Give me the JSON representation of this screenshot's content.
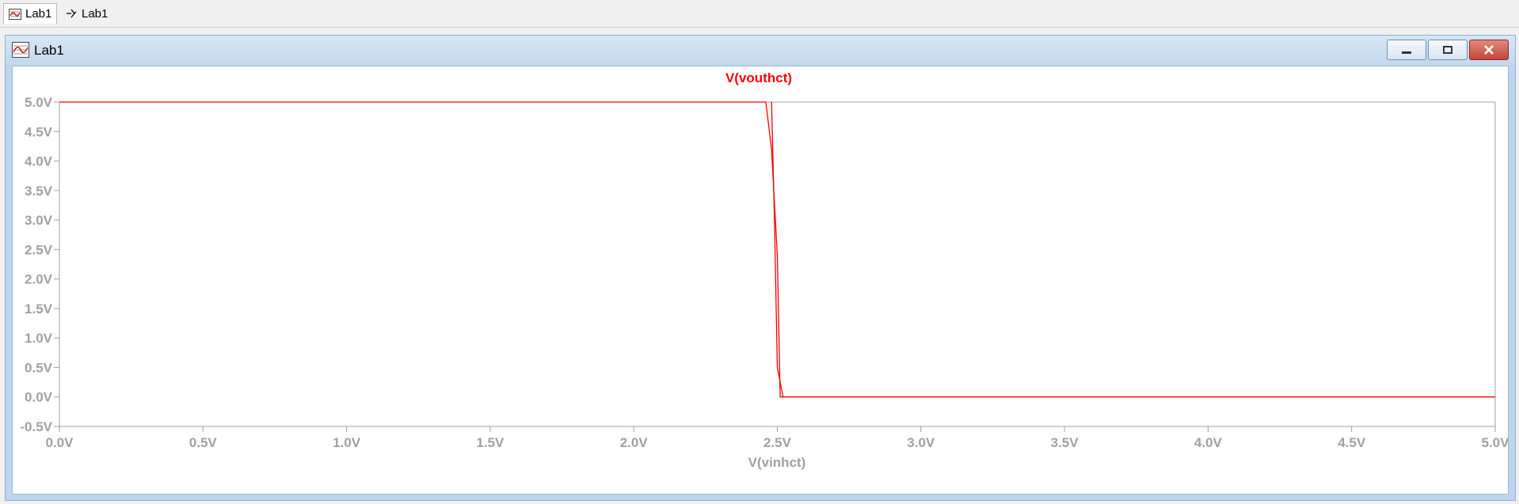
{
  "tabs": [
    {
      "label": "Lab1",
      "icon": "waveform-icon"
    },
    {
      "label": "Lab1",
      "icon": "schematic-icon"
    }
  ],
  "window": {
    "title": "Lab1",
    "icon": "waveform-icon",
    "buttons": [
      "minimize",
      "maximize",
      "close"
    ]
  },
  "colors": {
    "trace": "#ff0000",
    "axis_text": "#a0a0a0",
    "frame": "#a0a0a0"
  },
  "chart_data": {
    "type": "line",
    "title": "V(vouthct)",
    "xlabel": "V(vinhct)",
    "ylabel": "",
    "xlim": [
      0.0,
      5.0
    ],
    "ylim": [
      -0.5,
      5.0
    ],
    "x_ticks": [
      "0.0V",
      "0.5V",
      "1.0V",
      "1.5V",
      "2.0V",
      "2.5V",
      "3.0V",
      "3.5V",
      "4.0V",
      "4.5V",
      "5.0V"
    ],
    "y_ticks": [
      "5.0V",
      "4.5V",
      "4.0V",
      "3.5V",
      "3.0V",
      "2.5V",
      "2.0V",
      "1.5V",
      "1.0V",
      "0.5V",
      "0.0V",
      "-0.5V"
    ],
    "grid": false,
    "series": [
      {
        "name": "V(vouthct)",
        "x": [
          0.0,
          2.46,
          2.48,
          2.5,
          2.51,
          5.0
        ],
        "y": [
          5.0,
          5.0,
          4.2,
          2.4,
          0.0,
          0.0
        ]
      },
      {
        "name": "",
        "x": [
          2.48,
          2.49,
          2.5,
          2.52
        ],
        "y": [
          5.0,
          3.0,
          0.5,
          0.0
        ]
      }
    ]
  }
}
